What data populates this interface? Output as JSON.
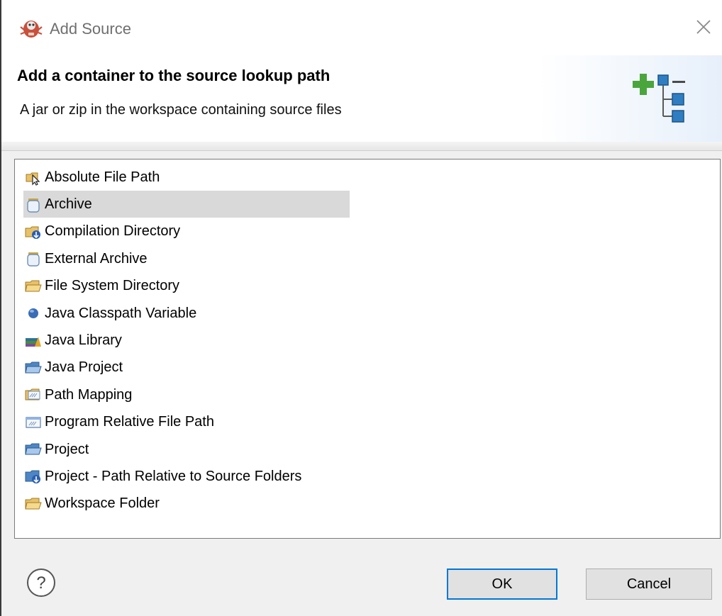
{
  "window": {
    "title": "Add Source",
    "app_icon": "eclipse-debug-icon",
    "close_icon": "close-icon"
  },
  "banner": {
    "title": "Add a container to the source lookup path",
    "description": "A jar or zip in the workspace containing source files",
    "icon": "add-container-icon"
  },
  "list": {
    "selected_index": 1,
    "items": [
      {
        "label": "Absolute File Path",
        "icon": "absolute-file-path-icon"
      },
      {
        "label": "Archive",
        "icon": "archive-jar-icon"
      },
      {
        "label": "Compilation Directory",
        "icon": "compilation-directory-icon"
      },
      {
        "label": "External Archive",
        "icon": "external-archive-icon"
      },
      {
        "label": "File System Directory",
        "icon": "folder-icon"
      },
      {
        "label": "Java Classpath Variable",
        "icon": "classpath-variable-icon"
      },
      {
        "label": "Java Library",
        "icon": "java-library-icon"
      },
      {
        "label": "Java Project",
        "icon": "java-project-icon"
      },
      {
        "label": "Path Mapping",
        "icon": "path-mapping-icon"
      },
      {
        "label": "Program Relative File Path",
        "icon": "program-relative-path-icon"
      },
      {
        "label": "Project",
        "icon": "project-folder-icon"
      },
      {
        "label": "Project - Path Relative to Source Folders",
        "icon": "project-relative-path-icon"
      },
      {
        "label": "Workspace Folder",
        "icon": "workspace-folder-icon"
      }
    ]
  },
  "footer": {
    "help_icon": "help-icon",
    "ok_label": "OK",
    "cancel_label": "Cancel"
  },
  "colors": {
    "accent": "#0078d7",
    "selection": "#d9d9d9",
    "dialog_background": "#f0f0f0"
  }
}
